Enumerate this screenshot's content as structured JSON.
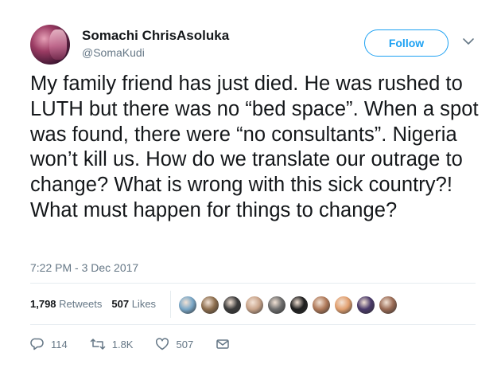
{
  "author": {
    "display_name": "Somachi ChrisAsoluka",
    "handle": "@SomaKudi"
  },
  "follow_button": {
    "label": "Follow"
  },
  "tweet": {
    "text": "My family friend has just died. He was rushed to LUTH but there was no “bed space”. When a spot was found, there were “no consultants”. Nigeria won’t kill us. How do we translate our outrage to change? What is wrong with this sick country?! What must happen for things to change?",
    "timestamp": "7:22 PM - 3 Dec 2017"
  },
  "stats": {
    "retweets_count": "1,798",
    "retweets_label": "Retweets",
    "likes_count": "507",
    "likes_label": "Likes"
  },
  "likers": [
    {
      "icon": "liker-avatar",
      "color": "#7aa7c7"
    },
    {
      "icon": "liker-avatar",
      "color": "#8d6e4e"
    },
    {
      "icon": "liker-avatar",
      "color": "#3b3b3b"
    },
    {
      "icon": "liker-avatar",
      "color": "#c9a48a"
    },
    {
      "icon": "liker-avatar",
      "color": "#6d6d6d"
    },
    {
      "icon": "liker-avatar",
      "color": "#1f1f1f"
    },
    {
      "icon": "liker-avatar",
      "color": "#b07a5a"
    },
    {
      "icon": "liker-avatar",
      "color": "#e2a070"
    },
    {
      "icon": "liker-avatar",
      "color": "#4a3a6a"
    },
    {
      "icon": "liker-avatar",
      "color": "#9a6b55"
    }
  ],
  "actions": {
    "reply_count": "114",
    "retweet_count": "1.8K",
    "like_count": "507"
  },
  "colors": {
    "accent": "#1da1f2",
    "secondary_text": "#657786",
    "primary_text": "#14171a"
  }
}
